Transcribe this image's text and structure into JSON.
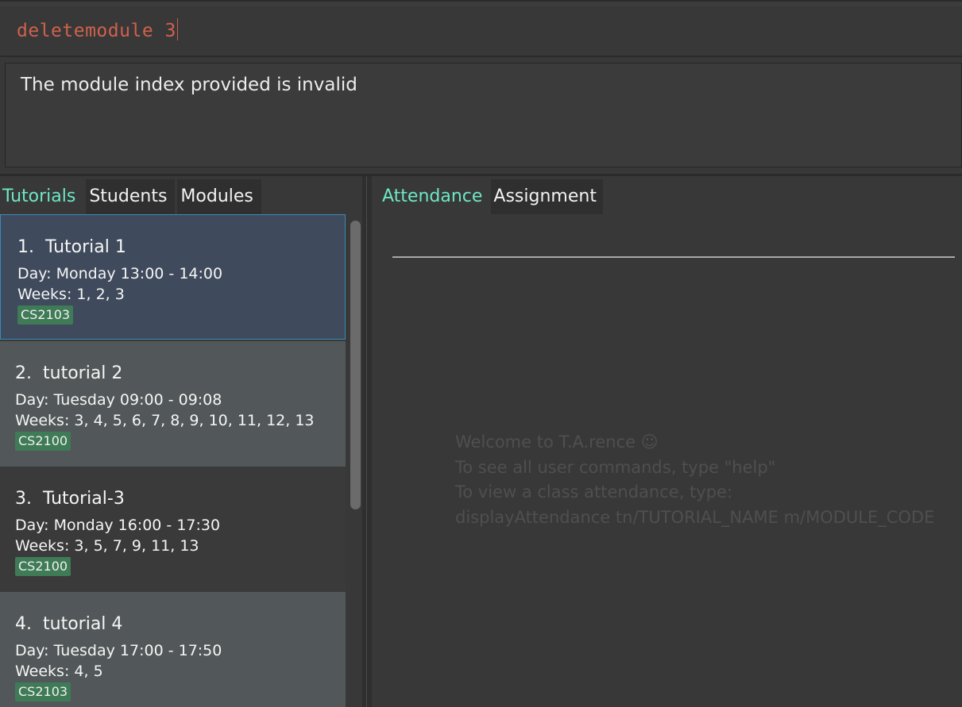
{
  "command_box": {
    "value": "deletemodule 3"
  },
  "result_display": {
    "message": "The module index provided is invalid"
  },
  "left_tabs": [
    {
      "label": "Tutorials",
      "active": true
    },
    {
      "label": "Students",
      "active": false
    },
    {
      "label": "Modules",
      "active": false
    }
  ],
  "tutorials": [
    {
      "index": "1.",
      "name": "Tutorial 1",
      "day": "Day: Monday 13:00 - 14:00",
      "weeks": "Weeks: 1, 2, 3",
      "module": "CS2103",
      "selected": true
    },
    {
      "index": "2.",
      "name": "tutorial 2",
      "day": "Day: Tuesday 09:00 - 09:08",
      "weeks": "Weeks: 3, 4, 5, 6, 7, 8, 9, 10, 11, 12, 13",
      "module": "CS2100",
      "selected": false
    },
    {
      "index": "3.",
      "name": "Tutorial-3",
      "day": "Day: Monday 16:00 - 17:30",
      "weeks": "Weeks: 3, 5, 7, 9, 11, 13",
      "module": "CS2100",
      "selected": false
    },
    {
      "index": "4.",
      "name": "tutorial 4",
      "day": "Day: Tuesday 17:00 - 17:50",
      "weeks": "Weeks: 4, 5",
      "module": "CS2103",
      "selected": false
    }
  ],
  "right_tabs": [
    {
      "label": "Attendance",
      "active": true
    },
    {
      "label": "Assignment",
      "active": false
    }
  ],
  "welcome": {
    "line1": "Welcome to T.A.rence ☺",
    "line2": "To see all user commands, type \"help\"",
    "line3": "To view a class attendance, type:",
    "line4": "displayAttendance tn/TUTORIAL_NAME m/MODULE_CODE"
  },
  "colors": {
    "command_text": "#d0614d",
    "active_tab": "#6ee8c4",
    "tag_bg": "#3e7b56",
    "selected_border": "#3a8bb7"
  }
}
